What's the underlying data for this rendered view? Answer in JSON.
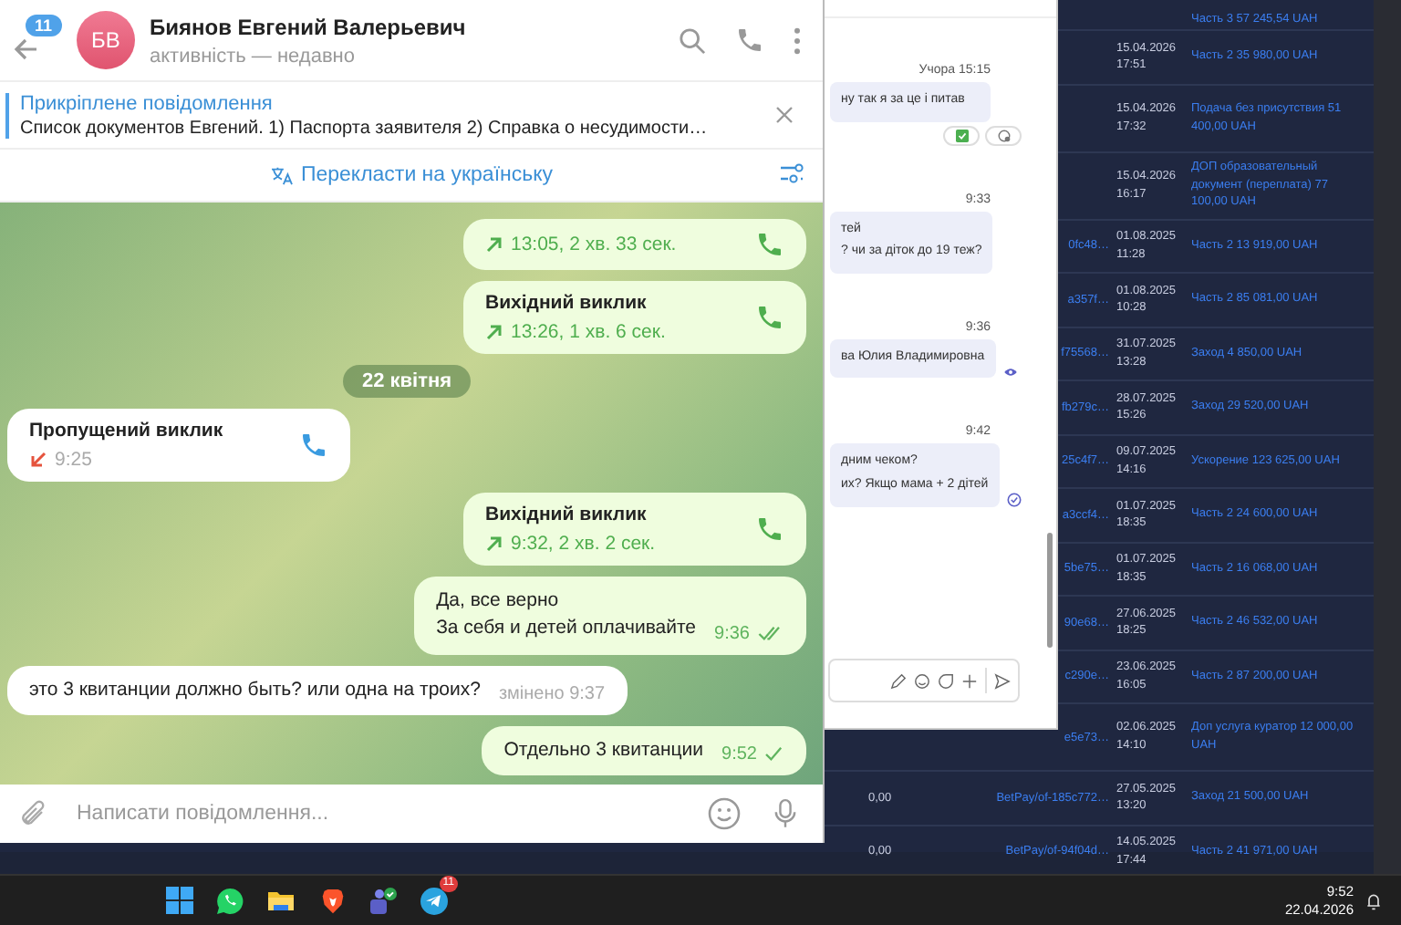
{
  "telegram": {
    "header": {
      "unread_badge": "11",
      "avatar_initials": "БВ",
      "name": "Биянов Евгений Валерьевич",
      "status": "активність — недавно"
    },
    "pinned": {
      "title": "Прикріплене повідомлення",
      "text": "Список документов Евгений.  1) Паспорта заявителя 2) Справка о несудимости…"
    },
    "translate": "Перекласти на українську",
    "messages": [
      {
        "kind": "call",
        "incoming": false,
        "missed": false,
        "info": "13:05, 2 хв. 33 сек."
      },
      {
        "kind": "call",
        "incoming": false,
        "title": "Вихідний виклик",
        "missed": false,
        "info": "13:26, 1 хв. 6 сек."
      },
      {
        "kind": "date",
        "label": "22 квітня"
      },
      {
        "kind": "call",
        "incoming": true,
        "title": "Пропущений виклик",
        "missed": true,
        "info": "9:25"
      },
      {
        "kind": "call",
        "incoming": false,
        "title": "Вихідний виклик",
        "missed": false,
        "info": "9:32, 2 хв. 2 сек."
      },
      {
        "kind": "text",
        "incoming": false,
        "text": "Да, все верно\nЗа себя и детей оплачивайте",
        "time": "9:36",
        "read": true
      },
      {
        "kind": "text",
        "incoming": true,
        "text": "это 3 квитанции должно быть? или одна на троих?",
        "time": "змінено 9:37"
      },
      {
        "kind": "text",
        "incoming": false,
        "text": "Отдельно 3 квитанции",
        "time": "9:52",
        "read": false
      }
    ],
    "composer": {
      "placeholder": "Написати повідомлення..."
    }
  },
  "chat_panel": {
    "messages": [
      {
        "time": "Учора 15:15",
        "text": "ну так я за це і питав",
        "reactions": true
      },
      {
        "time": "9:33",
        "text": "тей\n? чи за діток до 19 теж?"
      },
      {
        "time": "9:36",
        "text": "ва Юлия Владимировна",
        "seen": true
      },
      {
        "time": "9:42",
        "text": "дним чеком?\nих? Якщо мама + 2 дітей",
        "seen": false
      }
    ]
  },
  "payments": {
    "rows": [
      {
        "date": "",
        "time": "",
        "description": "Часть 3 57 245,54 UAH"
      },
      {
        "date": "15.04.2026",
        "time": "17:51",
        "description": "Часть 2 35 980,00 UAH"
      },
      {
        "date": "15.04.2026",
        "time": "17:32",
        "description": "Подача без присутствия 51 400,00 UAH"
      },
      {
        "date": "15.04.2026",
        "time": "16:17",
        "description": "ДОП образовательный документ (переплата) 77 100,00 UAH"
      },
      {
        "id": "0fc48…",
        "date": "01.08.2025",
        "time": "11:28",
        "description": "Часть 2 13 919,00 UAH"
      },
      {
        "id": "a357f…",
        "date": "01.08.2025",
        "time": "10:28",
        "description": "Часть 2 85 081,00 UAH"
      },
      {
        "id": "f75568…",
        "date": "31.07.2025",
        "time": "13:28",
        "description": "Заход 4 850,00 UAH"
      },
      {
        "id": "fb279c…",
        "date": "28.07.2025",
        "time": "15:26",
        "description": "Заход 29 520,00 UAH"
      },
      {
        "id": "25c4f7…",
        "date": "09.07.2025",
        "time": "14:16",
        "description": "Ускорение 123 625,00 UAH"
      },
      {
        "id": "a3ccf4…",
        "date": "01.07.2025",
        "time": "18:35",
        "description": "Часть 2 24 600,00 UAH"
      },
      {
        "id": "5be75…",
        "date": "01.07.2025",
        "time": "18:35",
        "description": "Часть 2 16 068,00 UAH"
      },
      {
        "id": "90e68…",
        "date": "27.06.2025",
        "time": "18:25",
        "description": "Часть 2 46 532,00 UAH"
      },
      {
        "id": "c290e…",
        "date": "23.06.2025",
        "time": "16:05",
        "description": "Часть 2 87 200,00 UAH"
      },
      {
        "id": "e5e73…",
        "date": "02.06.2025",
        "time": "14:10",
        "description": "Доп услуга куратор 12 000,00 UAH"
      },
      {
        "amount": "0,00",
        "id": "BetPay/of-185c772…",
        "date": "27.05.2025",
        "time": "13:20",
        "description": "Заход 21 500,00 UAH"
      },
      {
        "amount": "0,00",
        "id": "BetPay/of-94f04d…",
        "date": "14.05.2025",
        "time": "17:44",
        "description": "Часть 2 41 971,00 UAH"
      }
    ]
  },
  "taskbar": {
    "apps": [
      {
        "kind": "windows"
      },
      {
        "kind": "whatsapp"
      },
      {
        "kind": "folder"
      },
      {
        "kind": "brave"
      },
      {
        "kind": "teams"
      },
      {
        "kind": "telegram",
        "badge": "11"
      }
    ],
    "time": "9:52",
    "date": "22.04.2026"
  }
}
